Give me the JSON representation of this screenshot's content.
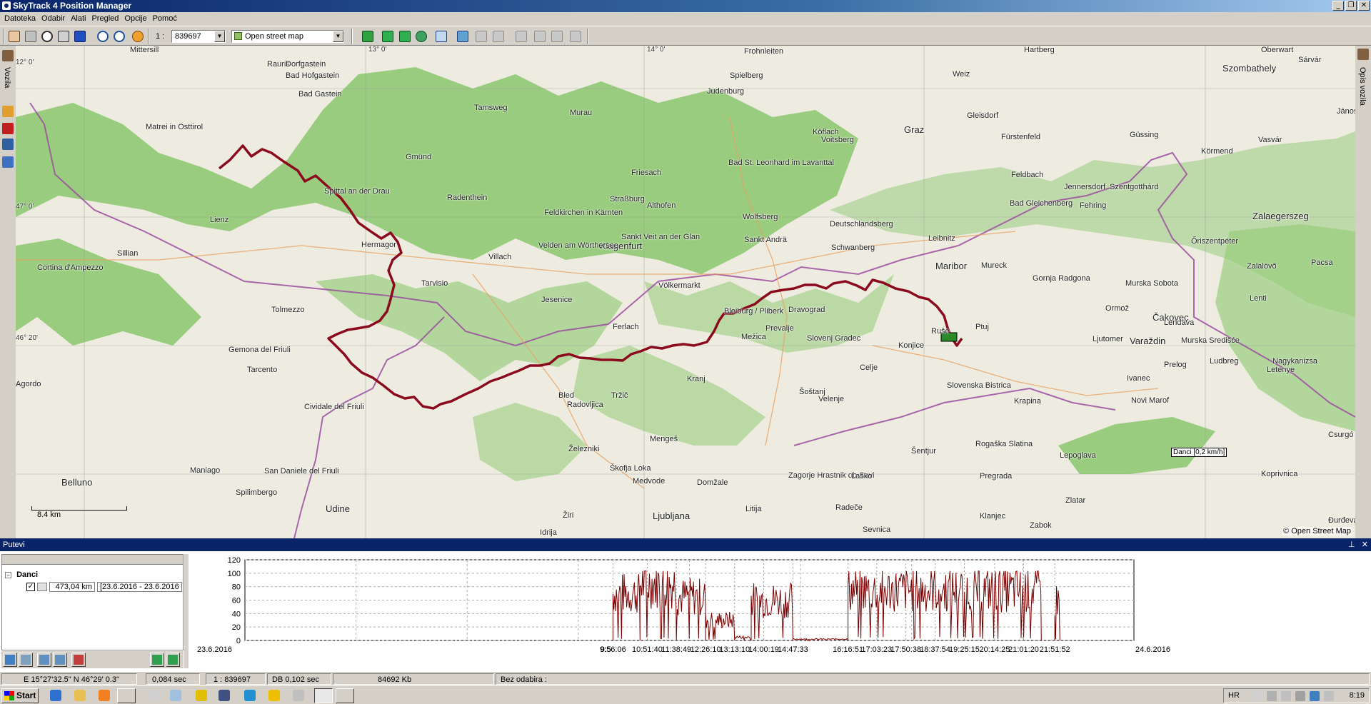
{
  "window": {
    "title": "SkyTrack 4 Position Manager",
    "minimize": "_",
    "restore": "❐",
    "close": "✕"
  },
  "menu": [
    "Datoteka",
    "Odabir",
    "Alati",
    "Pregled",
    "Opcije",
    "Pomoć"
  ],
  "toolbar": {
    "scale_prefix": "1 :",
    "scale_value": "839697",
    "map_source": "Open street map"
  },
  "left_panel": {
    "tab_label": "Vozila"
  },
  "right_panel": {
    "tab_label": "Opis vozila"
  },
  "map": {
    "cities": [
      {
        "name": "Klagenfurt",
        "size": "big"
      },
      {
        "name": "Graz",
        "size": "big"
      },
      {
        "name": "Maribor",
        "size": "big"
      },
      {
        "name": "Ljubljana",
        "size": "big"
      },
      {
        "name": "Szombathely",
        "size": "big"
      },
      {
        "name": "Zalaegerszeg",
        "size": "big"
      },
      {
        "name": "Čakovec",
        "size": "big"
      },
      {
        "name": "Varaždin",
        "size": "big"
      },
      {
        "name": "Belluno",
        "size": "big"
      },
      {
        "name": "Udine",
        "size": "big"
      },
      {
        "name": "Lienz",
        "size": "mid"
      },
      {
        "name": "Villach",
        "size": "mid"
      },
      {
        "name": "Wolfsberg",
        "size": "mid"
      },
      {
        "name": "Judenburg",
        "size": "mid"
      },
      {
        "name": "Murau",
        "size": "mid"
      },
      {
        "name": "Leibnitz",
        "size": "mid"
      },
      {
        "name": "Murska Sobota",
        "size": "mid"
      },
      {
        "name": "Ptuj",
        "size": "mid"
      },
      {
        "name": "Celje",
        "size": "mid"
      },
      {
        "name": "Kranj",
        "size": "mid"
      },
      {
        "name": "Jesenice",
        "size": "mid"
      },
      {
        "name": "Tarvisio",
        "size": "mid"
      },
      {
        "name": "Tolmezzo",
        "size": "mid"
      },
      {
        "name": "Ivanec",
        "size": "mid"
      },
      {
        "name": "Ludbreg",
        "size": "mid"
      },
      {
        "name": "Novi Marof",
        "size": "mid"
      },
      {
        "name": "Krapina",
        "size": "mid"
      },
      {
        "name": "Cortina d'Ampezzo",
        "size": "mid"
      },
      {
        "name": "Gemona del Friuli",
        "size": "mid"
      },
      {
        "name": "Tarcento",
        "size": "mid"
      },
      {
        "name": "Cividale del Friuli",
        "size": "mid"
      },
      {
        "name": "Spittal an der Drau",
        "size": "mid"
      },
      {
        "name": "Feldkirchen in Kärnten",
        "size": "mid"
      },
      {
        "name": "Bad Gastein",
        "size": "mid"
      },
      {
        "name": "Bad Hofgastein",
        "size": "mid"
      },
      {
        "name": "Matrei in Osttirol",
        "size": "mid"
      },
      {
        "name": "Sillian",
        "size": "mid"
      },
      {
        "name": "Gmünd",
        "size": "mid"
      },
      {
        "name": "Radenthein",
        "size": "mid"
      },
      {
        "name": "Hermagor",
        "size": "mid"
      },
      {
        "name": "Velden am Wörthersee",
        "size": "mid"
      },
      {
        "name": "Völkermarkt",
        "size": "mid"
      },
      {
        "name": "Bleiburg / Pliberk",
        "size": "mid"
      },
      {
        "name": "Dravograd",
        "size": "mid"
      },
      {
        "name": "Slovenj Gradec",
        "size": "mid"
      },
      {
        "name": "Velenje",
        "size": "mid"
      },
      {
        "name": "Šoštanj",
        "size": "mid"
      },
      {
        "name": "Domžale",
        "size": "mid"
      },
      {
        "name": "Medvode",
        "size": "mid"
      },
      {
        "name": "Škofja Loka",
        "size": "mid"
      },
      {
        "name": "Bled",
        "size": "mid"
      },
      {
        "name": "Radovljica",
        "size": "mid"
      },
      {
        "name": "Tržič",
        "size": "mid"
      },
      {
        "name": "Železniki",
        "size": "mid"
      },
      {
        "name": "Žiri",
        "size": "mid"
      },
      {
        "name": "Idrija",
        "size": "mid"
      },
      {
        "name": "Litija",
        "size": "mid"
      },
      {
        "name": "Zagorje Hrastnik ob Savi",
        "size": "mid"
      },
      {
        "name": "Laško",
        "size": "mid"
      },
      {
        "name": "Radeče",
        "size": "mid"
      },
      {
        "name": "Sevnica",
        "size": "mid"
      },
      {
        "name": "Šentjur",
        "size": "mid"
      },
      {
        "name": "Rogaška Slatina",
        "size": "mid"
      },
      {
        "name": "Pregrada",
        "size": "mid"
      },
      {
        "name": "Zlatar",
        "size": "mid"
      },
      {
        "name": "Zabok",
        "size": "mid"
      },
      {
        "name": "Klanjec",
        "size": "mid"
      },
      {
        "name": "Lepoglava",
        "size": "mid"
      },
      {
        "name": "Ormož",
        "size": "mid"
      },
      {
        "name": "Ljutomer",
        "size": "mid"
      },
      {
        "name": "Lendava",
        "size": "mid"
      },
      {
        "name": "Prelog",
        "size": "mid"
      },
      {
        "name": "Koprivnica",
        "size": "mid"
      },
      {
        "name": "Đurđevac",
        "size": "mid"
      },
      {
        "name": "Csurgó",
        "size": "mid"
      },
      {
        "name": "Nagykanizsa",
        "size": "mid"
      },
      {
        "name": "Letenye",
        "size": "mid"
      },
      {
        "name": "Lenti",
        "size": "mid"
      },
      {
        "name": "Zalalövő",
        "size": "mid"
      },
      {
        "name": "Őriszentpéter",
        "size": "mid"
      },
      {
        "name": "Szentgotthárd",
        "size": "mid"
      },
      {
        "name": "Jennersdorf",
        "size": "mid"
      },
      {
        "name": "Fehring",
        "size": "mid"
      },
      {
        "name": "Feldbach",
        "size": "mid"
      },
      {
        "name": "Bad Gleichenberg",
        "size": "mid"
      },
      {
        "name": "Fürstenfeld",
        "size": "mid"
      },
      {
        "name": "Güssing",
        "size": "mid"
      },
      {
        "name": "Körmend",
        "size": "mid"
      },
      {
        "name": "Vasvár",
        "size": "mid"
      },
      {
        "name": "Gleisdorf",
        "size": "mid"
      },
      {
        "name": "Weiz",
        "size": "mid"
      },
      {
        "name": "Hartberg",
        "size": "mid"
      },
      {
        "name": "Köflach",
        "size": "mid"
      },
      {
        "name": "Voitsberg",
        "size": "mid"
      },
      {
        "name": "Deutschlandsberg",
        "size": "mid"
      },
      {
        "name": "Schwanberg",
        "size": "mid"
      },
      {
        "name": "Bad St. Leonhard im Lavanttal",
        "size": "mid"
      },
      {
        "name": "Sankt Andrä",
        "size": "mid"
      },
      {
        "name": "Sankt Veit an der Glan",
        "size": "mid"
      },
      {
        "name": "Althofen",
        "size": "mid"
      },
      {
        "name": "Friesach",
        "size": "mid"
      },
      {
        "name": "Straßburg",
        "size": "mid"
      },
      {
        "name": "Tamsweg",
        "size": "mid"
      },
      {
        "name": "Spielberg",
        "size": "mid"
      },
      {
        "name": "Murska Središće",
        "size": "mid"
      },
      {
        "name": "Gornja Radgona",
        "size": "mid"
      },
      {
        "name": "Mureck",
        "size": "mid"
      },
      {
        "name": "Ruše",
        "size": "mid"
      },
      {
        "name": "Slovenska Bistrica",
        "size": "mid"
      },
      {
        "name": "Konjice",
        "size": "mid"
      },
      {
        "name": "Prevalje",
        "size": "mid"
      },
      {
        "name": "Mežica",
        "size": "mid"
      },
      {
        "name": "Ferlach",
        "size": "mid"
      },
      {
        "name": "Maniago",
        "size": "mid"
      },
      {
        "name": "Spilimbergo",
        "size": "mid"
      },
      {
        "name": "San Daniele del Friuli",
        "size": "mid"
      },
      {
        "name": "Agordo",
        "size": "mid"
      },
      {
        "name": "Mittersill",
        "size": "mid"
      },
      {
        "name": "Rauris",
        "size": "mid"
      },
      {
        "name": "Dorfgastein",
        "size": "mid"
      },
      {
        "name": "Frohnleiten",
        "size": "mid"
      },
      {
        "name": "Oberwart",
        "size": "mid"
      },
      {
        "name": "Sárvár",
        "size": "mid"
      },
      {
        "name": "Mengeš",
        "size": "mid"
      },
      {
        "name": "Pacsa",
        "size": "mid"
      },
      {
        "name": "Jánosháza",
        "size": "mid"
      }
    ],
    "coord_ticks": [
      "12° 0'",
      "13° 0'",
      "14° 0'",
      "46° 20'",
      "47° 0'"
    ],
    "scale_label": "8.4 km",
    "vehicle_label": "Danci [0,2 km/h]",
    "copyright": "© Open Street Map",
    "colors": {
      "forest": "#8fc973",
      "route": "#8b0a1e",
      "border": "#9b4ea0",
      "road": "#e8a060"
    }
  },
  "putevi": {
    "title": "Putevi",
    "pin": "⊥",
    "close": "✕",
    "tree": {
      "group": "Danci",
      "route_distance": "473,04 km",
      "route_dates": "[23.6.2016 - 23.6.2016"
    }
  },
  "chart_data": {
    "type": "line",
    "title": "",
    "xlabel": "",
    "ylabel": "",
    "ylim": [
      0,
      120
    ],
    "yticks": [
      0,
      20,
      40,
      60,
      80,
      100,
      120
    ],
    "x_start_label": "23.6.2016",
    "x_end_label": "24.6.2016",
    "x_tick_labels": [
      "9:56:06",
      "10:51:40",
      "11:38:49",
      "12:26:10",
      "13:13:10",
      "14:00:19",
      "14:47:33",
      "16:16:51",
      "17:03:23",
      "17:50:38",
      "18:37:54",
      "19:25:15",
      "20:14:25",
      "21:01:20",
      "21:51:52"
    ],
    "x_overlap_label": "9:5",
    "series": [
      {
        "name": "",
        "color": "#7a0000",
        "segments": [
          {
            "from": "9:56:06",
            "to": "10:40:00",
            "level": 70
          },
          {
            "from": "10:40:00",
            "to": "11:38:49",
            "level": 85
          },
          {
            "from": "11:38:49",
            "to": "12:26:10",
            "level": 65
          },
          {
            "from": "12:26:10",
            "to": "13:13:10",
            "level": 30
          },
          {
            "from": "13:13:10",
            "to": "13:40:00",
            "level": 5
          },
          {
            "from": "13:40:00",
            "to": "14:47:33",
            "level": 60
          },
          {
            "from": "14:47:33",
            "to": "16:16:51",
            "level": 2
          },
          {
            "from": "16:16:51",
            "to": "21:30:00",
            "level": 75
          },
          {
            "from": "21:51:52",
            "to": "22:00:00",
            "level": 60
          }
        ]
      }
    ]
  },
  "statusbar": {
    "coords": "E 15°27'32.5\" N 46°29' 0.3\"",
    "render_time": "0,084 sec",
    "scale": "1 : 839697",
    "db_time": "DB 0,102 sec",
    "memory": "84692 Kb",
    "selection": "Bez odabira :"
  },
  "taskbar": {
    "start_label": "Start",
    "lang": "HR",
    "clock": "8:19"
  }
}
